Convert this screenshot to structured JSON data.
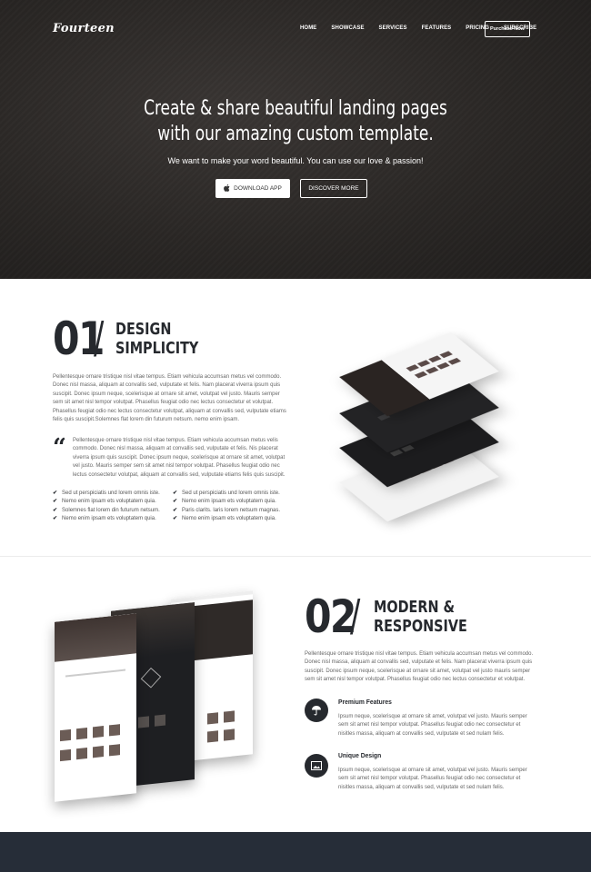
{
  "header": {
    "logo": "Fourteen",
    "nav": [
      "HOME",
      "SHOWCASE",
      "SERVICES",
      "FEATURES",
      "PRICING",
      "SUBSCRIBE"
    ],
    "purchase_label": "Purchase Now"
  },
  "hero": {
    "title_line1": "Create & share beautiful landing pages",
    "title_line2": "with our amazing custom template.",
    "subtitle": "We want to make your word beautiful. You can use our love & passion!",
    "download_label": "DOWNLOAD APP",
    "discover_label": "DISCOVER MORE"
  },
  "section1": {
    "number": "01",
    "heading_line1": "DESIGN",
    "heading_line2": "SIMPLICITY",
    "paragraph": "Pellentesque ornare tristique nisl vitae tempus. Etiam vehicula accumsan metus vel commodo. Donec nisl massa, aliquam at convallis sed, vulputate et felis. Nam placerat viverra ipsum quis suscipit. Donec ipsum neque, scelerisque at ornare sit amet, volutpat vel justo. Mauris semper sem sit amet nisl tempor volutpat. Phasellus feugiat odio nec lectus consectetur et volutpat. Phasellus feugiat odio nec lectus consectetur volutpat, aliquam at convallis sed, vulputate etiams felis quis suscipit.Solemnes flat lorem din futurum netsum. nemo enim ipsam.",
    "quote": "Pellentesque ornare tristique nisl vitae tempus. Etiam vehicula accumsan metus velis commodo. Donec nisl massa, aliquam at convallis sed, vulputate et felis. Nis placerat viverra ipsum quis suscipit. Donec ipsum neque, scelerisque at ornare sit amet, volutpat vel justo. Mauris semper sem sit amet nisl tempor volutpat. Phasellus feugiat odio nec lectus consectetur volutpat, aliquam at convallis sed, vulputate etiams felis quis suscipit.",
    "checklist_left": [
      "Sed ut perspiciatis und lorem omnis iste.",
      "Nemo enim ipsam ets voluptatem quia.",
      "Solemnes flat lorem din futurum netsum.",
      "Nemo enim ipsam ets voluptatem quia."
    ],
    "checklist_right": [
      "Sed ut perspiciatis und lorem omnis iste.",
      "Nemo enim ipsam ets voluptatem quia.",
      "Paris clarits. laris lorem netsum magnas.",
      "Nemo enim ipsam ets voluptatem quia."
    ]
  },
  "section2": {
    "number": "02",
    "heading_line1": "MODERN &",
    "heading_line2": "RESPONSIVE",
    "paragraph": "Pellentesque ornare tristique nisl vitae tempus. Etiam vehicula accumsan metus vel commodo. Donec nisl massa, aliquam at convallis sed, vulputate et felis. Nam placerat viverra ipsum quis suscipit. Donec ipsum neque, scelerisque at ornare sit amet, volutpat vel justo mauris semper sem sit amet nisl tempor volutpat. Phasellus feugiat odio nec lectus consectetur et volutpat.",
    "features": [
      {
        "title": "Premium Features",
        "icon": "umbrella-icon",
        "text": "Ipsum neque, scelerisque at ornare sit amet, volutpat vel justo. Mauris semper sem sit amet nisl tempor volutpat. Phasellus feugiat odio nec consectetur et nisitles massa, aliquam at convallis sed, vulputate et sed nulam felis."
      },
      {
        "title": "Unique Design",
        "icon": "image-icon",
        "text": "Ipsum neque, scelerisque at ornare sit amet, volutpat vel justo. Mauris semper sem sit amet nisl tempor volutpat. Phasellus feugiat odio nec consectetur et nisitles massa, aliquam at convallis sed, vulputate et sed nulam felis."
      }
    ]
  },
  "colors": {
    "hero_bg": "#2b2826",
    "dark_navy": "#262d38",
    "heading": "#26292e"
  }
}
